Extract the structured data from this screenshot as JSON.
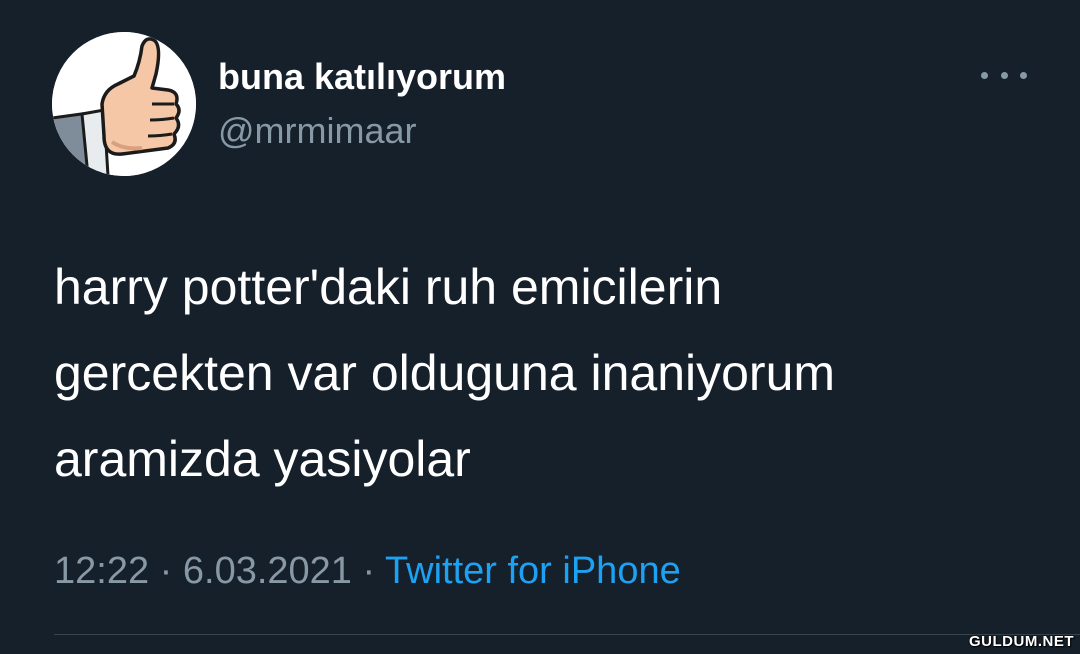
{
  "tweet": {
    "display_name": "buna katılıyorum",
    "handle": "@mrmimaar",
    "avatar_icon": "thumbs-up-icon",
    "more_icon": "more-dots-icon",
    "text_lines": [
      "harry potter'daki ruh emicilerin",
      "gercekten var olduguna inaniyorum",
      "aramizda yasiyolar"
    ],
    "time": "12:22",
    "separator": "·",
    "date": "6.03.2021",
    "source": "Twitter for iPhone"
  },
  "watermark": "GULDUM.NET",
  "colors": {
    "background": "#15202b",
    "primary_text": "#ffffff",
    "secondary_text": "#8899a6",
    "link": "#1da1f2",
    "divider": "#38444d"
  }
}
